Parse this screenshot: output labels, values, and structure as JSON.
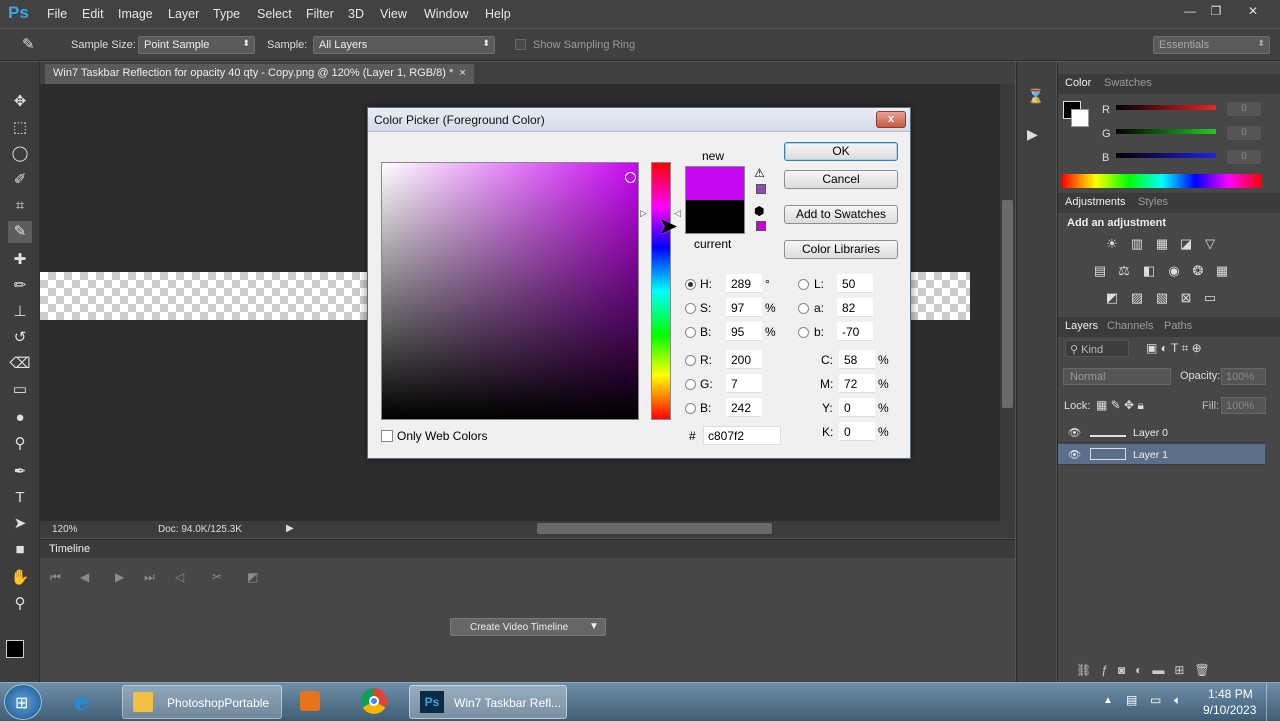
{
  "app": {
    "logo": "Ps"
  },
  "menu": [
    "File",
    "Edit",
    "Image",
    "Layer",
    "Type",
    "Select",
    "Filter",
    "3D",
    "View",
    "Window",
    "Help"
  ],
  "window_controls": {
    "minimize": "—",
    "restore": "❐",
    "close": "✕"
  },
  "options": {
    "sample_size_label": "Sample Size:",
    "sample_size_value": "Point Sample",
    "sample_label": "Sample:",
    "sample_value": "All Layers",
    "show_ring_label": "Show Sampling Ring",
    "workspace": "Essentials"
  },
  "document": {
    "tab_title": "Win7 Taskbar Reflection for opacity 40 qty  - Copy.png @ 120% (Layer 1, RGB/8) *",
    "tab_close": "×",
    "zoom": "120%",
    "doc_size": "Doc: 94.0K/125.3K"
  },
  "timeline": {
    "title": "Timeline",
    "create_button": "Create Video Timeline"
  },
  "color_panel": {
    "tabs": [
      "Color",
      "Swatches"
    ],
    "channels": [
      {
        "label": "R",
        "value": "0",
        "color": "#e22"
      },
      {
        "label": "G",
        "value": "0",
        "color": "#2c2"
      },
      {
        "label": "B",
        "value": "0",
        "color": "#22e"
      }
    ]
  },
  "adjustments_panel": {
    "tabs": [
      "Adjustments",
      "Styles"
    ],
    "heading": "Add an adjustment"
  },
  "layers_panel": {
    "tabs": [
      "Layers",
      "Channels",
      "Paths"
    ],
    "filter_kind": "Kind",
    "blend_mode": "Normal",
    "opacity_label": "Opacity:",
    "opacity_value": "100%",
    "lock_label": "Lock:",
    "fill_label": "Fill:",
    "fill_value": "100%",
    "layers": [
      {
        "name": "Layer 0",
        "selected": false
      },
      {
        "name": "Layer 1",
        "selected": true
      }
    ]
  },
  "color_picker": {
    "title": "Color Picker (Foreground Color)",
    "close": "x",
    "new_label": "new",
    "current_label": "current",
    "new_color": "#c807f2",
    "current_color": "#000000",
    "buttons": {
      "ok": "OK",
      "cancel": "Cancel",
      "add_swatches": "Add to Swatches",
      "libraries": "Color Libraries"
    },
    "only_web_colors": "Only Web Colors",
    "hsb": [
      {
        "label": "H:",
        "value": "289",
        "unit": "°",
        "selected": true
      },
      {
        "label": "S:",
        "value": "97",
        "unit": "%",
        "selected": false
      },
      {
        "label": "B:",
        "value": "95",
        "unit": "%",
        "selected": false
      }
    ],
    "rgb": [
      {
        "label": "R:",
        "value": "200"
      },
      {
        "label": "G:",
        "value": "7"
      },
      {
        "label": "B:",
        "value": "242"
      }
    ],
    "lab": [
      {
        "label": "L:",
        "value": "50"
      },
      {
        "label": "a:",
        "value": "82"
      },
      {
        "label": "b:",
        "value": "-70"
      }
    ],
    "cmyk": [
      {
        "label": "C:",
        "value": "58",
        "unit": "%"
      },
      {
        "label": "M:",
        "value": "72",
        "unit": "%"
      },
      {
        "label": "Y:",
        "value": "0",
        "unit": "%"
      },
      {
        "label": "K:",
        "value": "0",
        "unit": "%"
      }
    ],
    "hash": "#",
    "hex": "c807f2"
  },
  "taskbar": {
    "items": [
      "PhotoshopPortable",
      "Win7 Taskbar Refl..."
    ],
    "time": "1:48 PM",
    "date": "9/10/2023"
  }
}
